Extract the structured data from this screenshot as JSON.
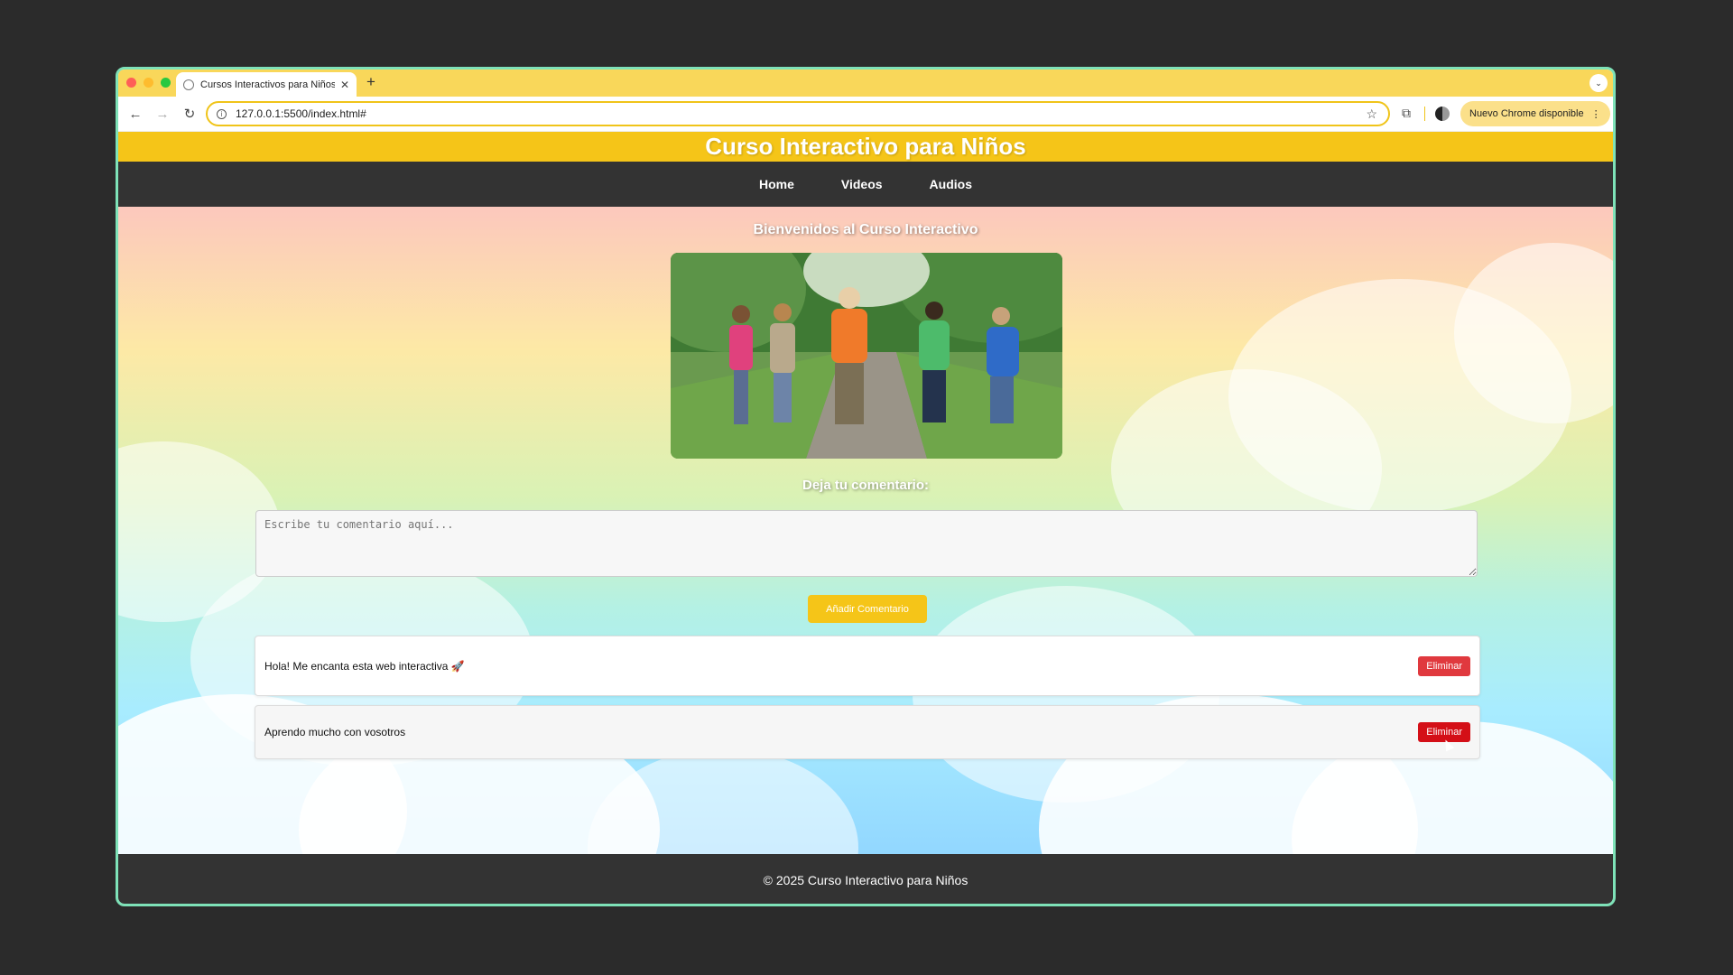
{
  "browser": {
    "tab_title": "Cursos Interactivos para Niños",
    "tab_close": "✕",
    "new_tab": "+",
    "tab_menu": "⌄",
    "back": "←",
    "forward": "→",
    "reload": "↻",
    "url": "127.0.0.1:5500/index.html#",
    "star": "☆",
    "extensions": "⧉",
    "update_label": "Nuevo Chrome disponible",
    "update_menu": "⋮"
  },
  "site": {
    "title": "Curso Interactivo para Niños",
    "nav": [
      {
        "label": "Home"
      },
      {
        "label": "Videos"
      },
      {
        "label": "Audios"
      }
    ],
    "welcome": "Bienvenidos al Curso Interactivo",
    "comment_label": "Deja tu comentario:",
    "comment_placeholder": "Escribe tu comentario aquí...",
    "add_button": "Añadir Comentario",
    "comments": [
      {
        "text": "Hola! Me encanta esta web interactiva 🚀",
        "delete_label": "Eliminar"
      },
      {
        "text": "Aprendo mucho con vosotros",
        "delete_label": "Eliminar"
      }
    ],
    "footer": "© 2025 Curso Interactivo para Niños"
  },
  "colors": {
    "accent": "#f5c518",
    "delete": "#e0393e",
    "dark": "#333333"
  }
}
